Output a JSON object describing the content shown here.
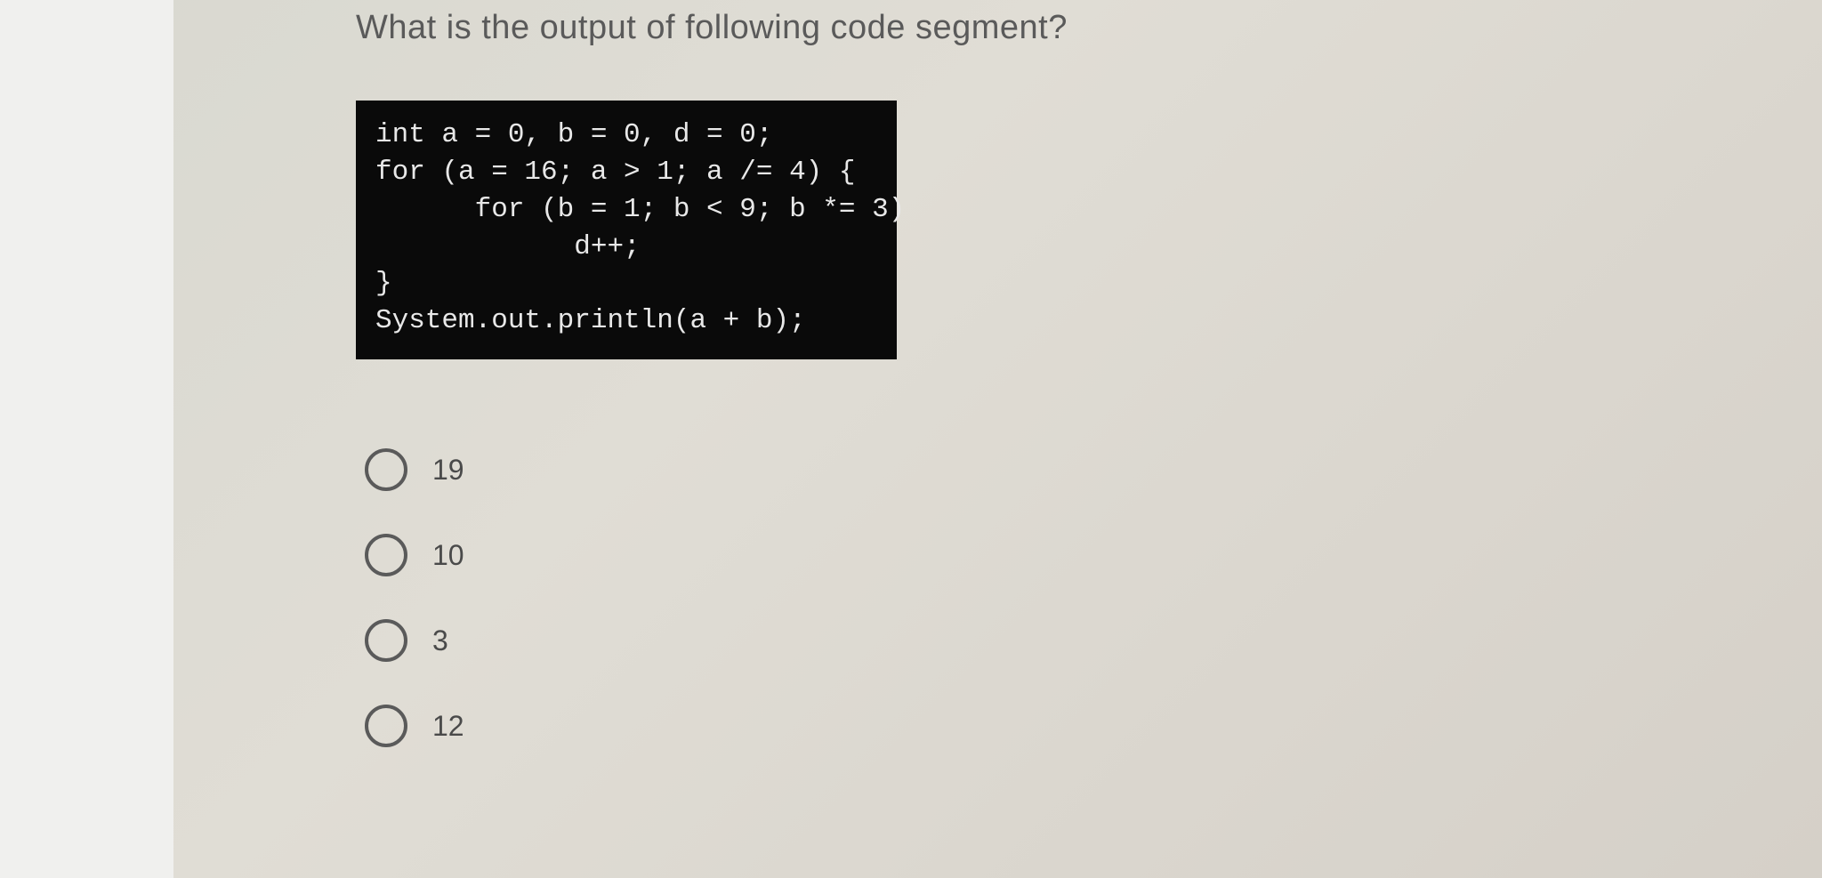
{
  "question": {
    "text": "What is the output of following code segment?"
  },
  "code": {
    "line1": "int a = 0, b = 0, d = 0;",
    "line2": "for (a = 16; a > 1; a /= 4) {",
    "line3": "      for (b = 1; b < 9; b *= 3)",
    "line4": "            d++;",
    "line5": "}",
    "line6": "System.out.println(a + b);"
  },
  "options": [
    {
      "label": "19"
    },
    {
      "label": "10"
    },
    {
      "label": "3"
    },
    {
      "label": "12"
    }
  ]
}
